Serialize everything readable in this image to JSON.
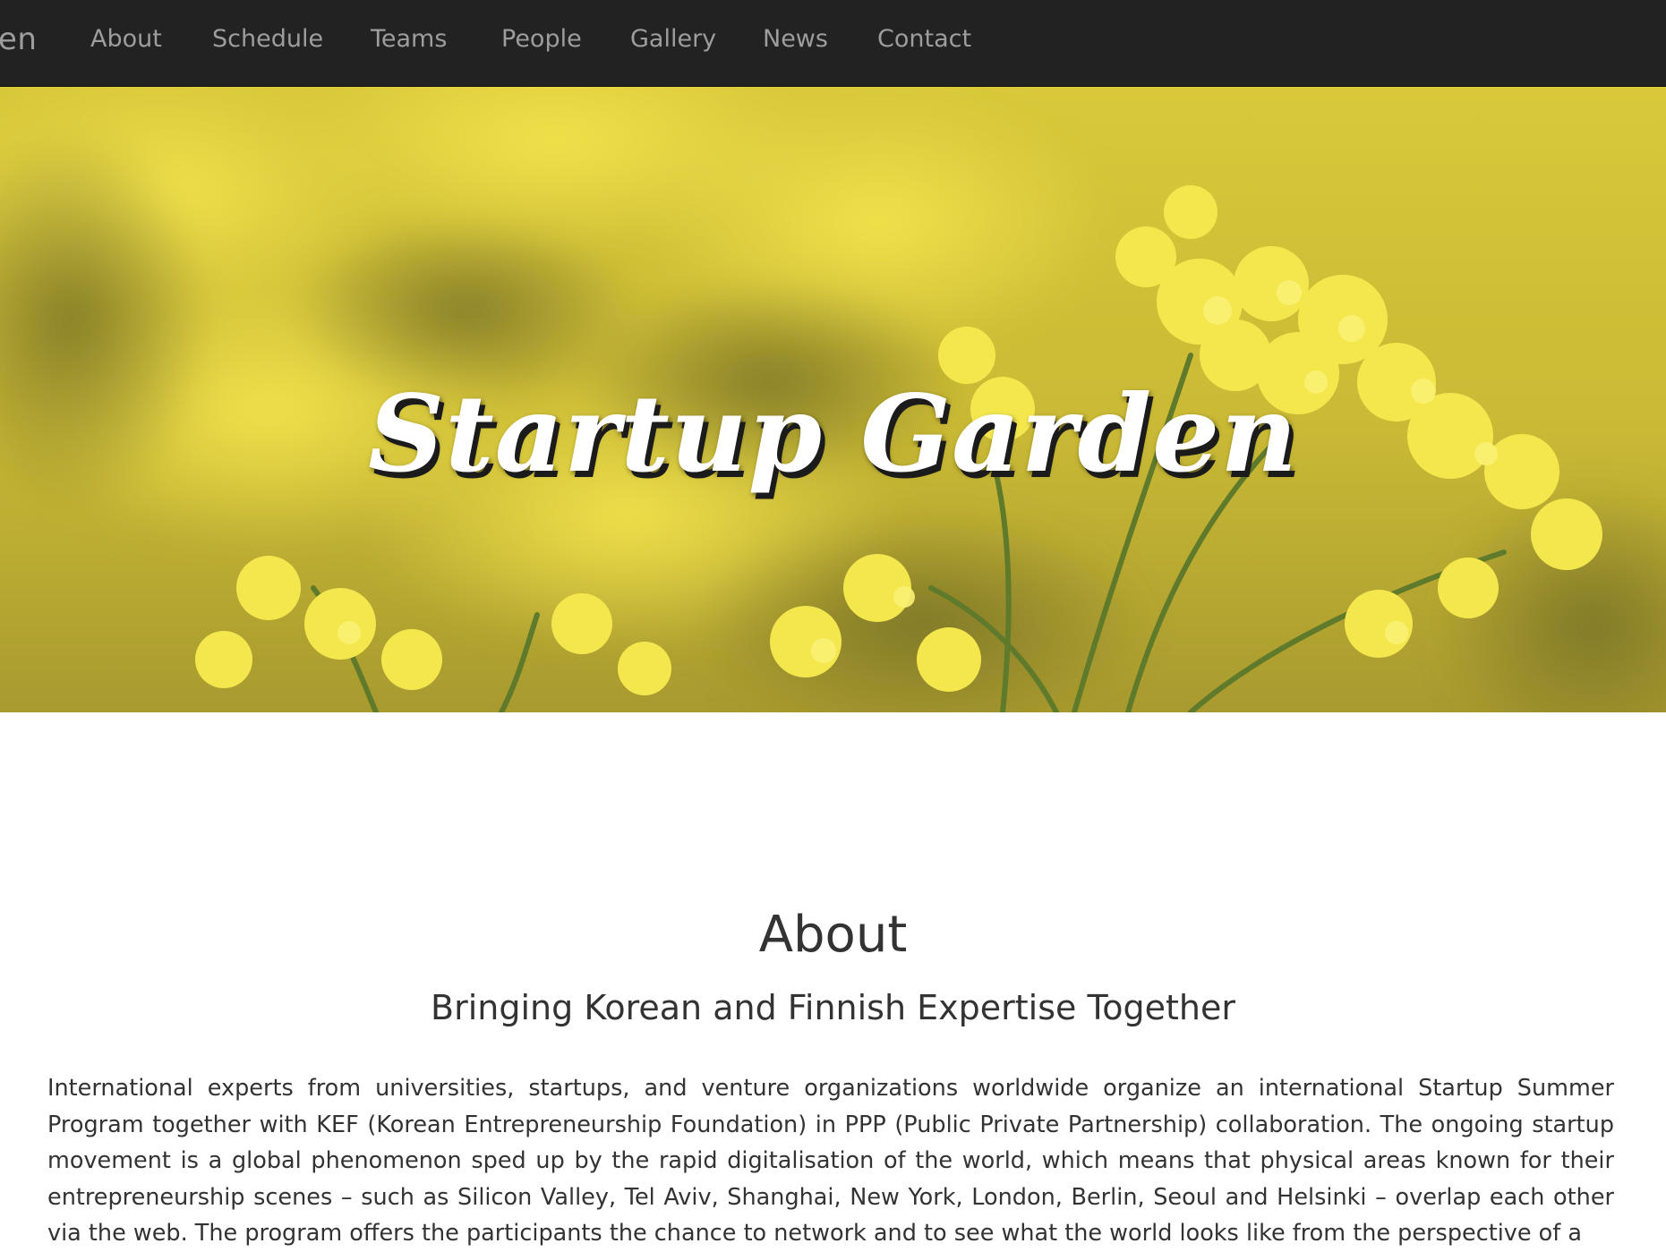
{
  "navbar": {
    "brand": "en",
    "links": [
      "About",
      "Schedule",
      "Teams",
      "People",
      "Gallery",
      "News",
      "Contact"
    ]
  },
  "hero": {
    "title": "Startup Garden"
  },
  "about": {
    "heading": "About",
    "subheading": "Bringing Korean and Finnish Expertise Together",
    "body": "International experts from universities, startups, and venture organizations worldwide organize an international Startup Summer Program together with KEF (Korean Entrepreneurship Foundation) in PPP (Public Private Partnership) collaboration. The ongoing startup movement is a global phenomenon sped up by the rapid digitalisation of the world, which means that physical areas known for their entrepreneurship scenes – such as Silicon Valley, Tel Aviv, Shanghai, New York, London, Berlin, Seoul and Helsinki – overlap each other via the web. The program offers the participants the chance to network and to see what the world looks like from the perspective of a"
  },
  "colors": {
    "navbar_bg": "#222222",
    "nav_text": "#9d9d9d",
    "hero_yellow": "#e8d940",
    "text": "#333333"
  }
}
